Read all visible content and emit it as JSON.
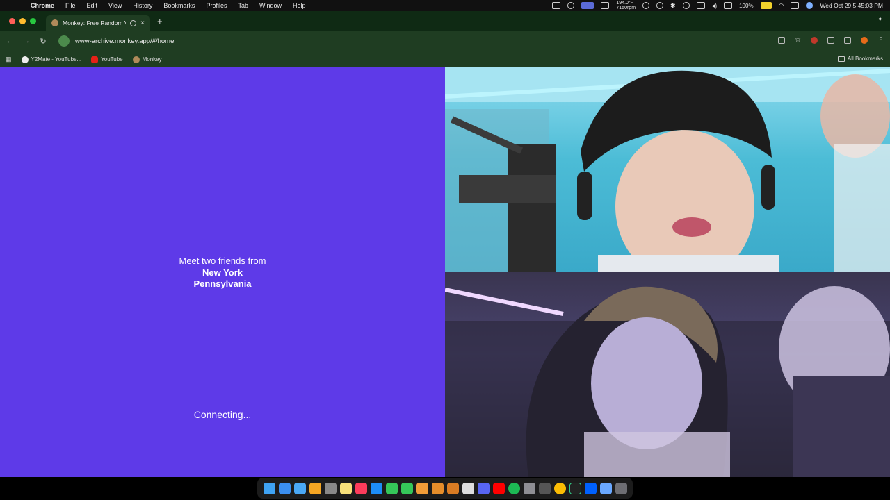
{
  "menubar": {
    "app_name": "Chrome",
    "items": [
      "File",
      "Edit",
      "View",
      "History",
      "Bookmarks",
      "Profiles",
      "Tab",
      "Window",
      "Help"
    ],
    "weather": "194.0°F",
    "weather_sub": "7150rpm",
    "battery": "100%",
    "datetime": "Wed Oct 29  5:45:03 PM"
  },
  "browser": {
    "tab_title": "Monkey: Free Random Vi",
    "new_tab_label": "+",
    "url": "www-archive.monkey.app/#/home",
    "bookmarks": [
      "Y2Mate - YouTube...",
      "YouTube",
      "Monkey"
    ],
    "all_bookmarks": "All Bookmarks"
  },
  "left_panel": {
    "meet_text": "Meet two friends from",
    "location_1": "New York",
    "location_2": "Pennsylvania",
    "status": "Connecting..."
  },
  "colors": {
    "panel_bg": "#5e3ae8",
    "chrome_bg": "#1f3d22"
  }
}
